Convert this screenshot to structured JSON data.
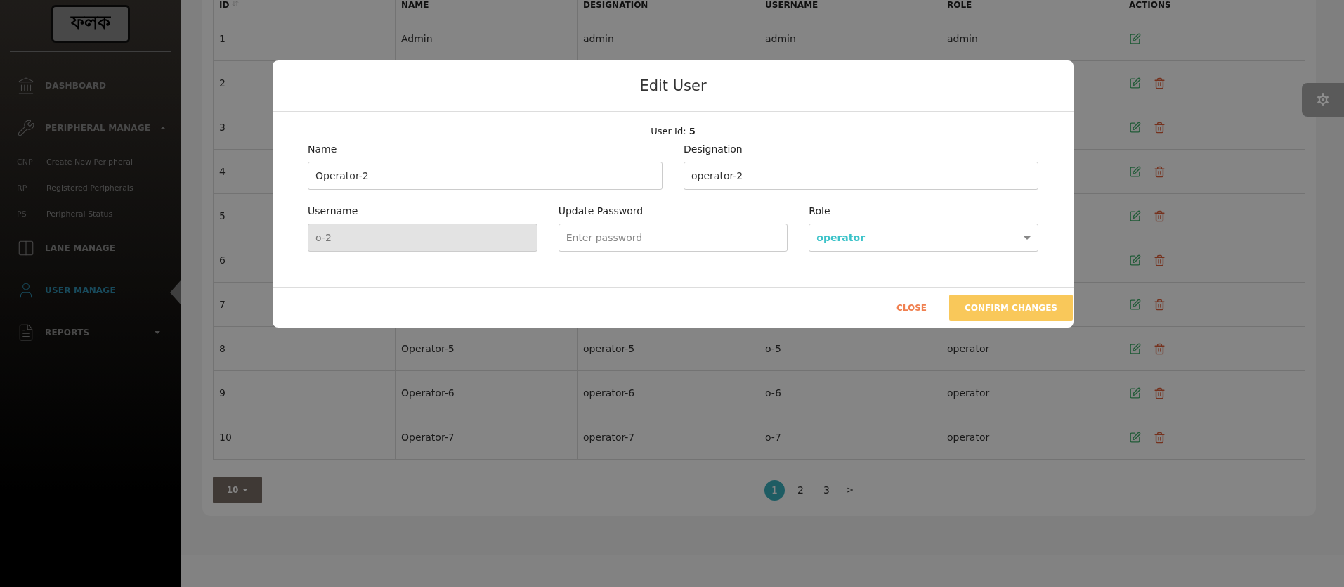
{
  "sidebar": {
    "logo": "ফলক",
    "items": [
      {
        "kind": "item",
        "label": "DASHBOARD",
        "selected": false
      },
      {
        "kind": "group",
        "label": "PERIPHERAL MANAGE",
        "selected": false,
        "expanded": true,
        "children": [
          {
            "abbr": "CNP",
            "label": "Create New Peripheral"
          },
          {
            "abbr": "RP",
            "label": "Registered Peripherals"
          },
          {
            "abbr": "PS",
            "label": "Peripheral Status"
          }
        ]
      },
      {
        "kind": "item",
        "label": "LANE MANAGE",
        "selected": false
      },
      {
        "kind": "item",
        "label": "USER MANAGE",
        "selected": true
      },
      {
        "kind": "group",
        "label": "REPORTS",
        "selected": false,
        "expanded": false
      }
    ]
  },
  "table": {
    "columns": [
      "ID",
      "NAME",
      "DESIGNATION",
      "USERNAME",
      "ROLE",
      "ACTIONS"
    ],
    "rows": [
      {
        "id": "1",
        "name": "Admin",
        "designation": "admin",
        "username": "admin",
        "role": "admin",
        "deletable": false
      },
      {
        "id": "2",
        "deletable": true
      },
      {
        "id": "3",
        "deletable": true
      },
      {
        "id": "4",
        "deletable": true
      },
      {
        "id": "5",
        "deletable": true
      },
      {
        "id": "6",
        "deletable": true
      },
      {
        "id": "7",
        "deletable": true
      },
      {
        "id": "8",
        "name": "Operator-5",
        "designation": "operator-5",
        "username": "o-5",
        "role": "operator",
        "deletable": true
      },
      {
        "id": "9",
        "name": "Operator-6",
        "designation": "operator-6",
        "username": "o-6",
        "role": "operator",
        "deletable": true
      },
      {
        "id": "10",
        "name": "Operator-7",
        "designation": "operator-7",
        "username": "o-7",
        "role": "operator",
        "deletable": true
      }
    ]
  },
  "page_size": "10",
  "pagination": {
    "pages": [
      {
        "label": "1",
        "selected": true
      },
      {
        "label": "2",
        "selected": false
      },
      {
        "label": "3",
        "selected": false
      }
    ],
    "next": ">"
  },
  "modal": {
    "title": "Edit User",
    "user_id": "User Id: **5**",
    "fields": [
      {
        "label": "Name",
        "kind": "text",
        "value": "Operator-2"
      },
      {
        "label": "Designation",
        "kind": "text",
        "value": "operator-2"
      },
      {
        "label": "Username",
        "kind": "text",
        "value": "o-2",
        "disabled": true
      },
      {
        "label": "Update Password",
        "kind": "text",
        "placeholder": "Enter password"
      },
      {
        "label": "Role",
        "kind": "select",
        "value": "operator"
      }
    ],
    "buttons": [
      {
        "label": "CLOSE",
        "kind": "text"
      },
      {
        "label": "CONFIRM CHANGES",
        "kind": "primary"
      }
    ]
  }
}
